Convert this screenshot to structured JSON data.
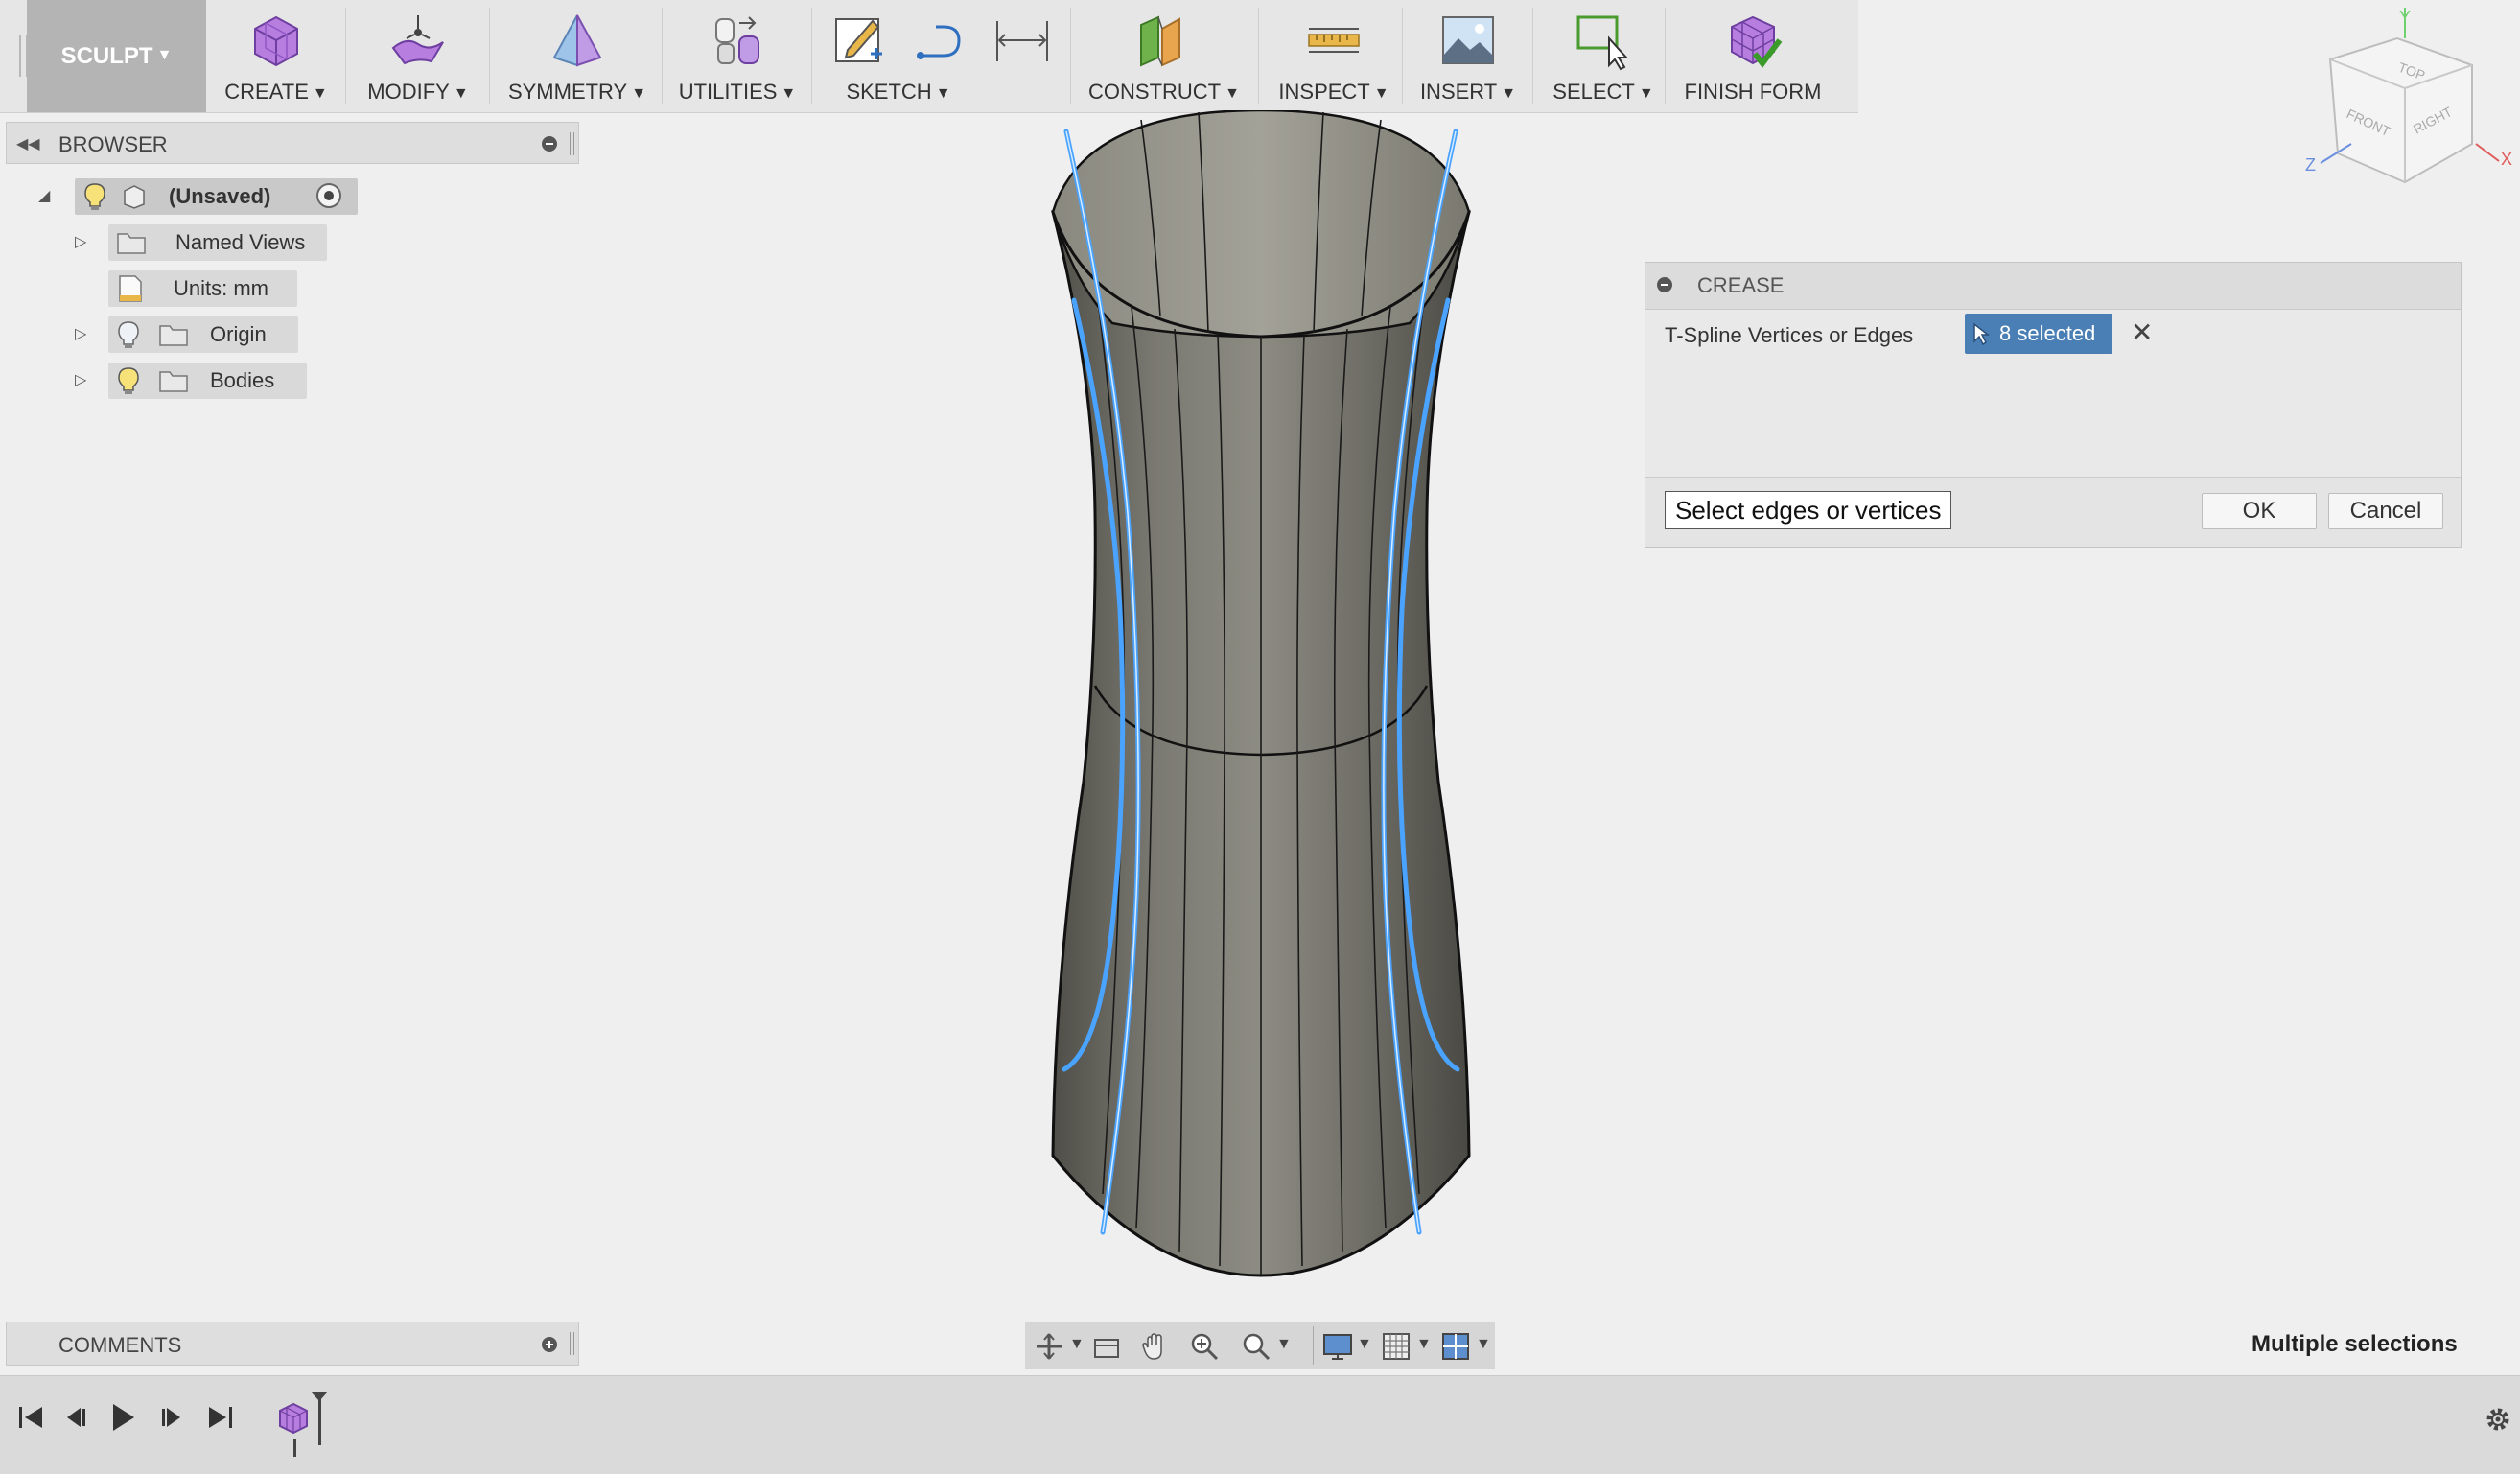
{
  "toolbar": {
    "workspace_label": "SCULPT",
    "items": [
      {
        "label": "CREATE",
        "icon": "create-box-icon"
      },
      {
        "label": "MODIFY",
        "icon": "modify-surface-icon"
      },
      {
        "label": "SYMMETRY",
        "icon": "symmetry-icon"
      },
      {
        "label": "UTILITIES",
        "icon": "utilities-icon"
      },
      {
        "label": "SKETCH",
        "icon": "sketch-icon"
      },
      {
        "label": "CONSTRUCT",
        "icon": "construct-plane-icon"
      },
      {
        "label": "INSPECT",
        "icon": "measure-icon"
      },
      {
        "label": "INSERT",
        "icon": "insert-image-icon"
      },
      {
        "label": "SELECT",
        "icon": "select-window-icon"
      },
      {
        "label": "FINISH FORM",
        "icon": "finish-form-icon"
      }
    ]
  },
  "browser": {
    "title": "BROWSER",
    "tree": [
      {
        "label": "(Unsaved)"
      },
      {
        "label": "Named Views"
      },
      {
        "label": "Units: mm"
      },
      {
        "label": "Origin"
      },
      {
        "label": "Bodies"
      }
    ]
  },
  "comments": {
    "title": "COMMENTS"
  },
  "viewcube": {
    "faces": [
      "TOP",
      "FRONT",
      "RIGHT"
    ],
    "axes": [
      "Y",
      "Z",
      "X"
    ]
  },
  "crease_dialog": {
    "title": "CREASE",
    "field_label": "T-Spline Vertices or Edges",
    "selection_text": "8 selected",
    "tooltip": "Select edges or vertices",
    "ok_label": "OK",
    "cancel_label": "Cancel"
  },
  "status": {
    "text": "Multiple selections"
  },
  "colors": {
    "accent": "#4a7fb5",
    "selected_edge": "#4aa3ff",
    "body": "#6b6a63"
  }
}
